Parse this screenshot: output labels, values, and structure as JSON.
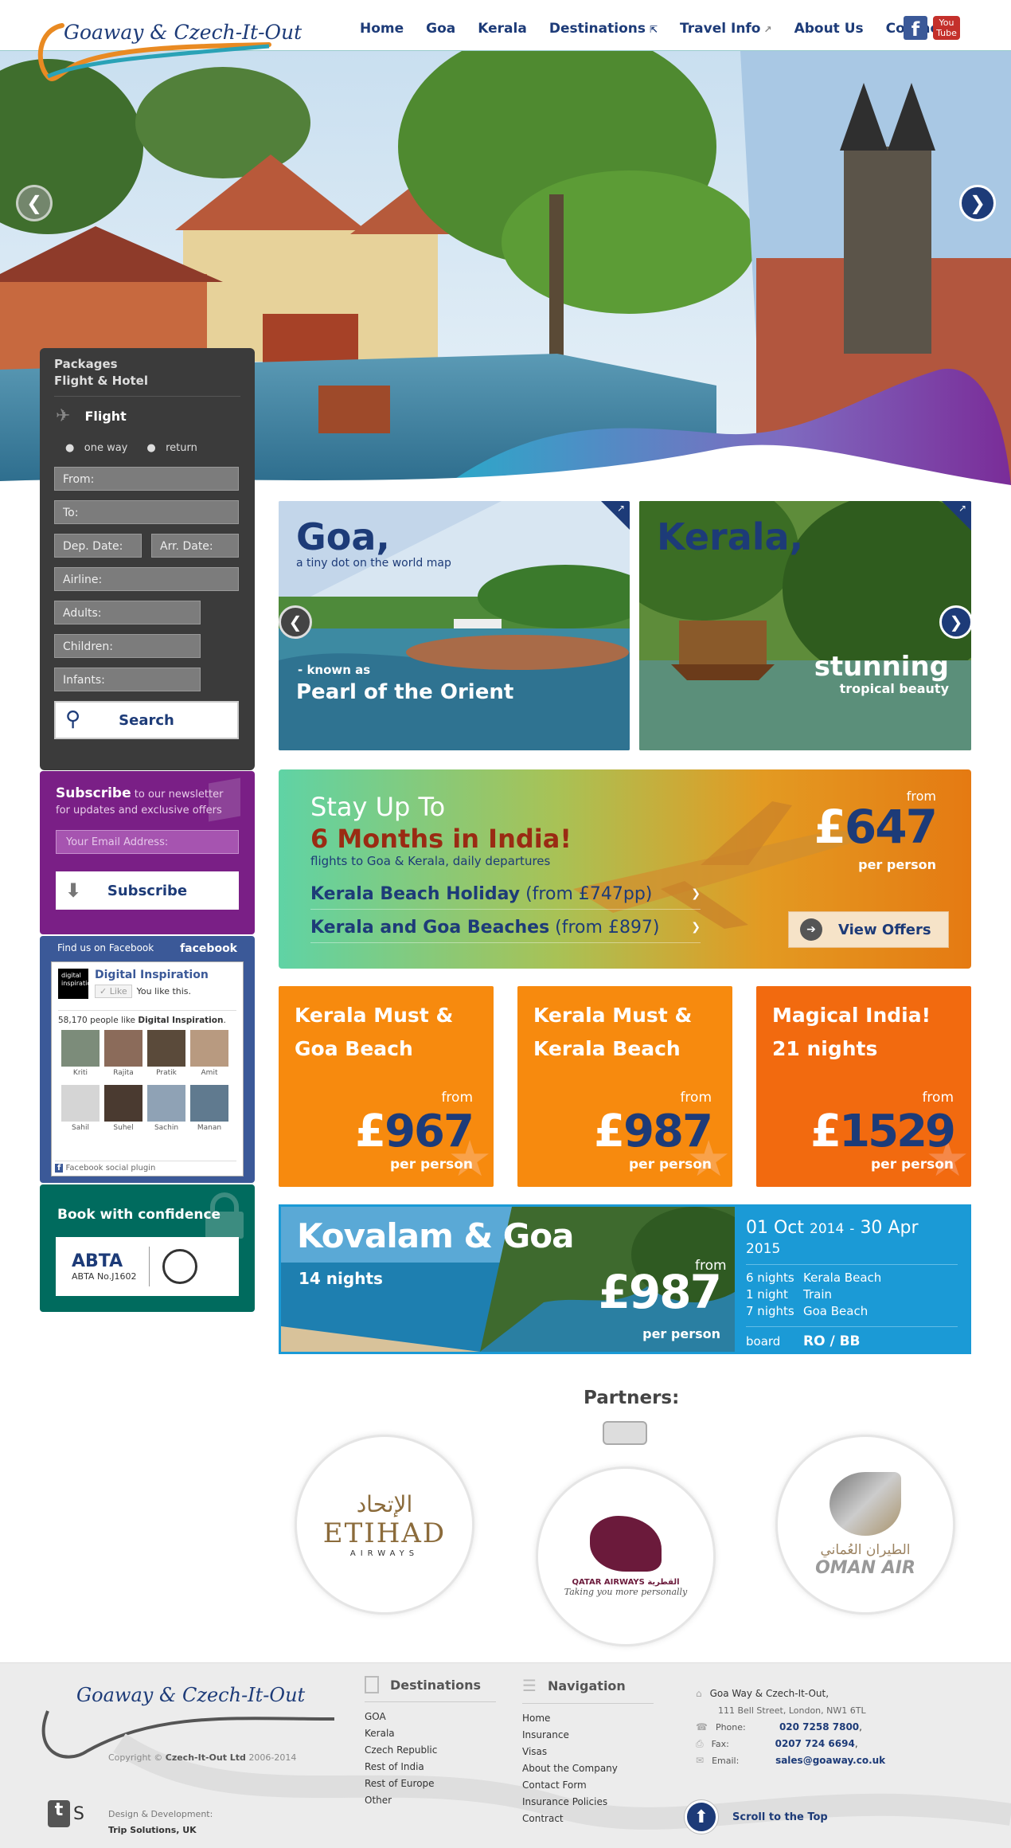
{
  "header": {
    "logo_text": "Goaway & Czech-It-Out",
    "nav": [
      "Home",
      "Goa",
      "Kerala",
      "Destinations",
      "Travel Info",
      "About Us",
      "Contact"
    ],
    "social": {
      "facebook": "f",
      "youtube_top": "You",
      "youtube_bottom": "Tube"
    }
  },
  "search": {
    "packages_label": "Packages",
    "flight_hotel_label": "Flight & Hotel",
    "flight_label": "Flight",
    "trip_options": [
      "one way",
      "return"
    ],
    "from_placeholder": "From:",
    "to_placeholder": "To:",
    "dep_date_placeholder": "Dep. Date:",
    "arr_date_placeholder": "Arr. Date:",
    "airline_placeholder": "Airline:",
    "adults_placeholder": "Adults:",
    "children_placeholder": "Children:",
    "infants_placeholder": "Infants:",
    "search_button": "Search"
  },
  "subscribe": {
    "title": "Subscribe",
    "text_a": "to our newsletter",
    "text_b": "for updates and exclusive offers",
    "email_placeholder": "Your Email Address:",
    "button": "Subscribe"
  },
  "facebook_widget": {
    "header": "Find us on Facebook",
    "brand": "facebook",
    "page_name": "Digital Inspiration",
    "page_thumb": "digital inspiration",
    "like": "Like",
    "liked_text": "You like this.",
    "count_text": "58,170 people like",
    "count_page": "Digital Inspiration",
    "faces": [
      "Kriti",
      "Rajita",
      "Pratik",
      "Amit",
      "Sahil",
      "Suhel",
      "Sachin",
      "Manan"
    ],
    "plugin": "Facebook social plugin"
  },
  "confidence": {
    "title": "Book with confidence",
    "abta": "ABTA",
    "abta_no": "ABTA No.J1602"
  },
  "destinations": {
    "goa": {
      "title": "Goa,",
      "subtitle": "a tiny dot on the world map",
      "known_as": "- known as",
      "tagline": "Pearl of the Orient"
    },
    "kerala": {
      "title": "Kerala,",
      "tagline": "stunning",
      "tagline_small": "tropical beauty"
    }
  },
  "offer": {
    "line1": "Stay Up To",
    "line2": "6 Months in India!",
    "line3": "flights to Goa & Kerala, daily departures",
    "deals": [
      {
        "name": "Kerala Beach Holiday",
        "price": "(from £747pp)"
      },
      {
        "name": "Kerala and Goa Beaches",
        "price": "(from £897)"
      }
    ],
    "from": "from",
    "currency": "£",
    "price": "647",
    "per_person": "per person",
    "button": "View Offers"
  },
  "cards": [
    {
      "title_a": "Kerala Must &",
      "title_b": "Goa Beach",
      "from": "from",
      "currency": "£",
      "price": "967",
      "per": "per person",
      "color": "#f78a0e"
    },
    {
      "title_a": "Kerala Must &",
      "title_b": "Kerala Beach",
      "from": "from",
      "currency": "£",
      "price": "987",
      "per": "per person",
      "color": "#f78a0e"
    },
    {
      "title_a": "Magical India!",
      "title_b": "21 nights",
      "from": "from",
      "currency": "£",
      "price": "1529",
      "per": "per person",
      "color": "#f26a0f"
    }
  ],
  "kovalam": {
    "title": "Kovalam & Goa",
    "nights": "14 nights",
    "from": "from",
    "currency": "£",
    "price": "987",
    "per": "per person",
    "date_from_day": "01 Oct",
    "date_from_year": "2014",
    "dash": "-",
    "date_to_day": "30 Apr",
    "date_to_year": "2015",
    "itinerary": [
      {
        "n": "6 nights",
        "what": "Kerala Beach"
      },
      {
        "n": "1 night",
        "what": "Train"
      },
      {
        "n": "7 nights",
        "what": "Goa Beach"
      }
    ],
    "board_label": "board",
    "board_value": "RO / BB"
  },
  "partners": {
    "title": "Partners:",
    "etihad_arabic": "الإتحاد",
    "etihad": "ETIHAD",
    "etihad_sub": "AIRWAYS",
    "qatar": "QATAR AIRWAYS",
    "qatar_arabic": "القطرية",
    "qatar_tag": "Taking you more personally",
    "oman_arabic": "الطيران العُماني",
    "oman": "OMAN AIR"
  },
  "footer": {
    "logo_text": "Goaway & Czech-It-Out",
    "copyright_pre": "Copyright ©",
    "copyright_company": "Czech-It-Out Ltd",
    "copyright_years": "2006-2014",
    "design_label": "Design & Development:",
    "design_company": "Trip Solutions, UK",
    "ts_logo_a": "t",
    "ts_logo_b": "S",
    "destinations_title": "Destinations",
    "destinations": [
      "GOA",
      "Kerala",
      "Czech Republic",
      "Rest of India",
      "Rest of Europe",
      "Other"
    ],
    "navigation_title": "Navigation",
    "navigation": [
      "Home",
      "Insurance",
      "Visas",
      "About the Company",
      "Contact Form",
      "Insurance Policies",
      "Contract"
    ],
    "company": "Goa Way & Czech-It-Out,",
    "address": "111 Bell Street, London, NW1 6TL",
    "phone_label": "Phone:",
    "phone": "020 7258 7800",
    "fax_label": "Fax:",
    "fax": "0207 724 6694",
    "email_label": "Email:",
    "email": "sales@goaway.co.uk",
    "scroll_top": "Scroll to the Top"
  }
}
